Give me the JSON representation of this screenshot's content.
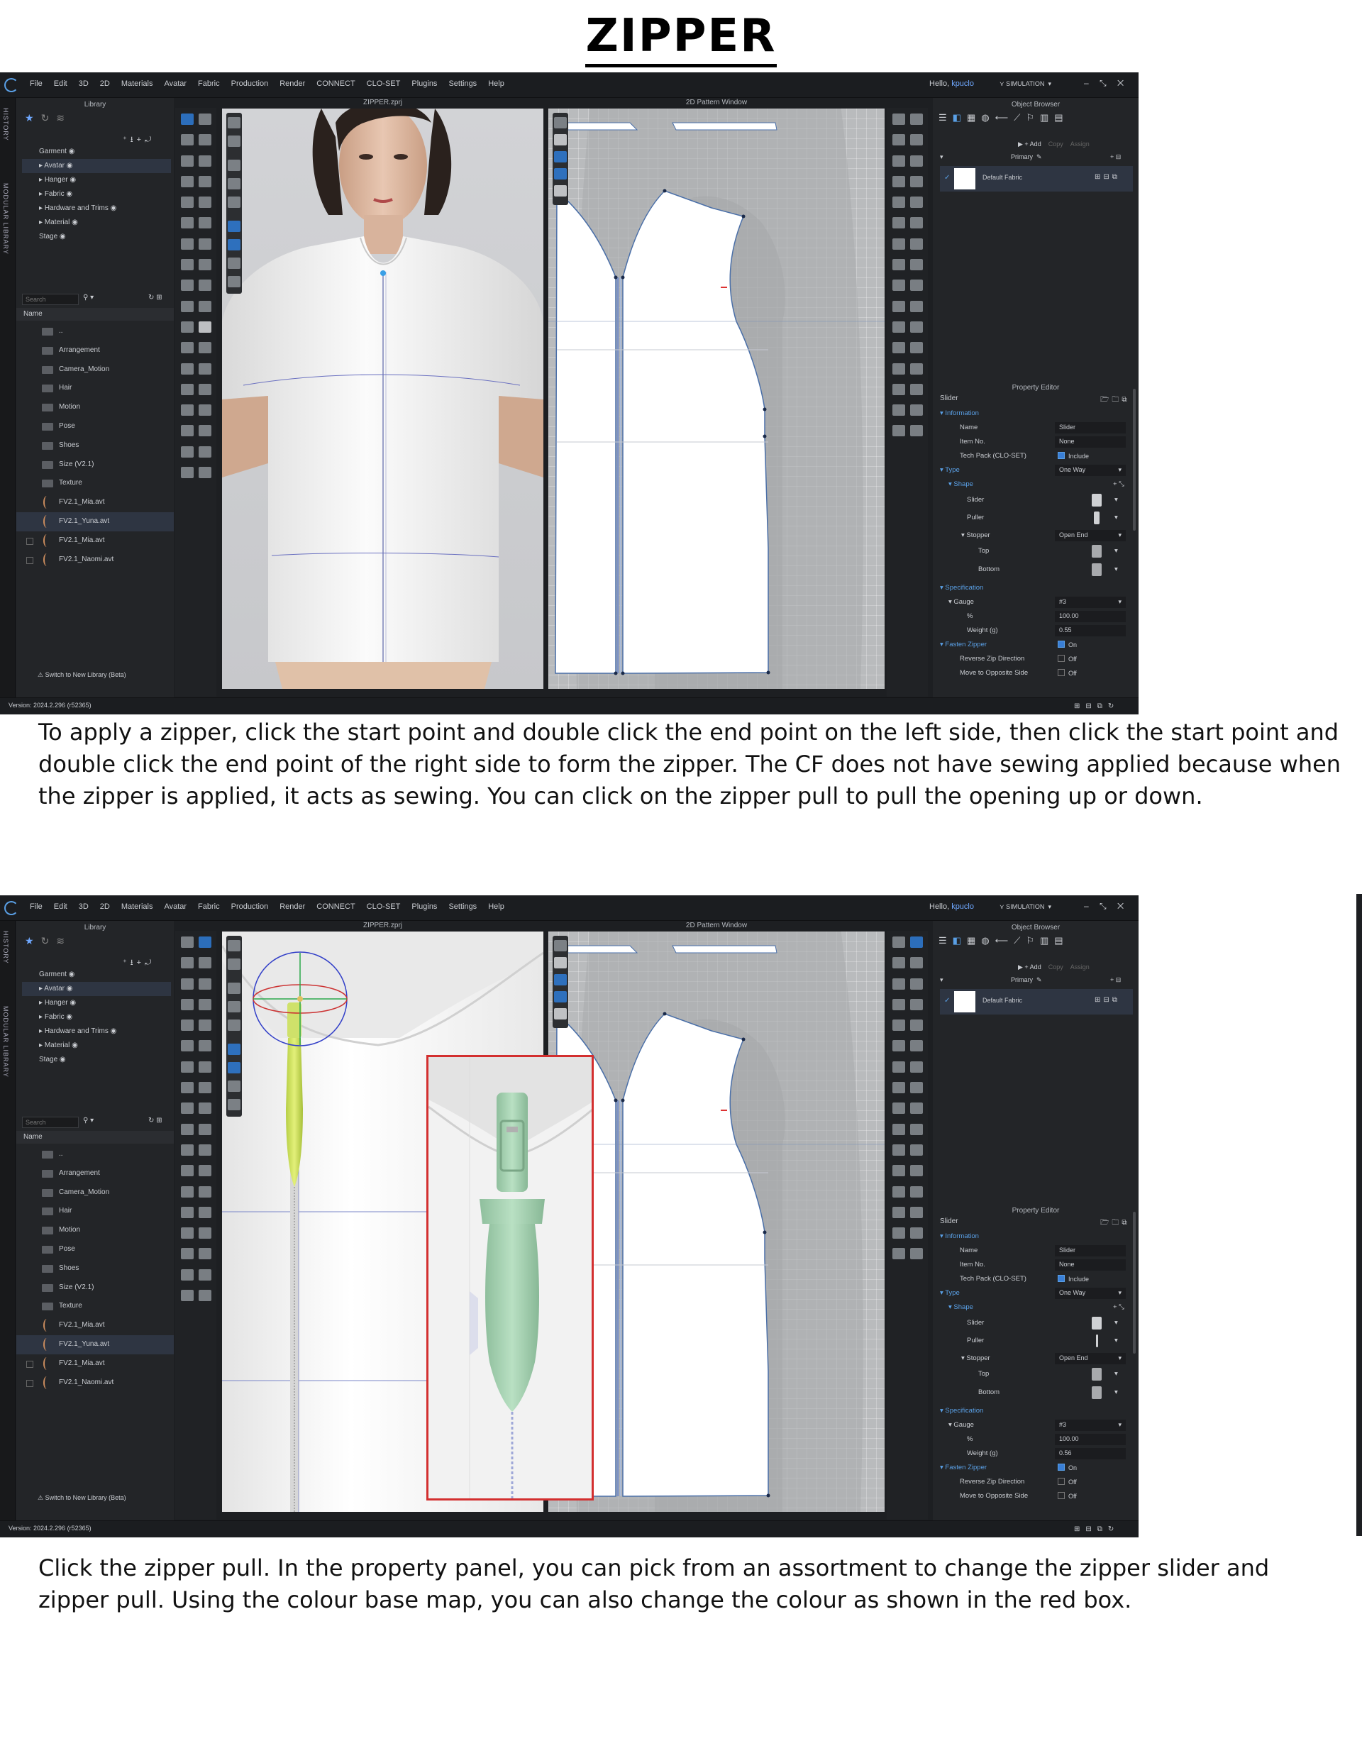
{
  "doc": {
    "title": "ZIPPER",
    "caption1": "To apply a zipper, click the start point and double click the end point on the left side, then click the start point and double click the end point of the right side to form the zipper. The CF does not have sewing applied because when the zipper is applied, it acts as sewing. You can click on the zipper pull to pull the opening up or down.",
    "caption2": "Click the zipper pull. In the property panel, you can pick from an assortment to change the zipper slider and zipper pull. Using the colour base map, you can also change the colour as shown in the red box."
  },
  "app": {
    "menu": [
      "File",
      "Edit",
      "3D",
      "2D",
      "Materials",
      "Avatar",
      "Fabric",
      "Production",
      "Render",
      "CONNECT",
      "CLO-SET",
      "Plugins",
      "Settings",
      "Help"
    ],
    "hello": "Hello,",
    "user": "kpuclo",
    "mode": "SIMULATION",
    "side_tabs": {
      "history": "HISTORY",
      "modular": "MODULAR LIBRARY"
    },
    "library": {
      "title": "Library",
      "tree": [
        "Garment",
        "Avatar",
        "Hanger",
        "Fabric",
        "Hardware and Trims",
        "Material",
        "Stage"
      ],
      "search_placeholder": "Search",
      "name_header": "Name",
      "files": [
        "..",
        "Arrangement",
        "Camera_Motion",
        "Hair",
        "Motion",
        "Pose",
        "Shoes",
        "Size (V2.1)",
        "Texture",
        "FV2.1_Mia.avt",
        "FV2.1_Yuna.avt",
        "FV2.1_Mia.avt",
        "FV2.1_Naomi.avt"
      ],
      "switch_label": "Switch to New Library (Beta)"
    },
    "version": "Version: 2024.2.296 (r52365)",
    "view3d_title": "ZIPPER.zprj",
    "view2d_title": "2D Pattern Window",
    "object_browser": {
      "title": "Object Browser",
      "add_label": "+ Add",
      "copy_label": "Copy",
      "assign_label": "Assign",
      "primary_label": "Primary",
      "fabric_name": "Default Fabric"
    },
    "property_editor": {
      "title": "Property Editor",
      "object": "Slider",
      "information": "Information",
      "name_label": "Name",
      "name_value": "Slider",
      "item_no_label": "Item No.",
      "item_no_value": "None",
      "tech_pack_label": "Tech Pack (CLO-SET)",
      "tech_pack_value": "Include",
      "type_label": "Type",
      "type_value": "One Way",
      "shape_label": "Shape",
      "slider_label": "Slider",
      "puller_label": "Puller",
      "stopper_label": "Stopper",
      "stopper_value": "Open End",
      "top_label": "Top",
      "bottom_label": "Bottom",
      "specification_label": "Specification",
      "gauge_label": "Gauge",
      "gauge_value": "#3",
      "percent_label": "%",
      "percent_value": "100.00",
      "weight_label": "Weight (g)",
      "fasten_label": "Fasten Zipper",
      "fasten_value": "On",
      "reverse_label": "Reverse Zip Direction",
      "reverse_value": "Off",
      "move_label": "Move to Opposite Side",
      "move_value": "Off"
    },
    "screens": [
      {
        "weight_value": "0.55"
      },
      {
        "weight_value": "0.56"
      }
    ]
  }
}
